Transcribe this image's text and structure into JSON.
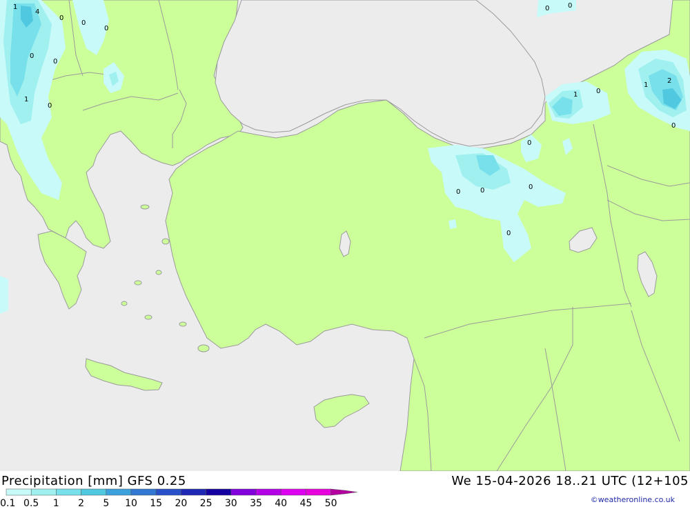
{
  "map": {
    "contour_labels": [
      "1",
      "4",
      "0",
      "0",
      "0",
      "0",
      "0",
      "1",
      "0",
      "0",
      "0",
      "1",
      "0",
      "1",
      "2",
      "0",
      "0",
      "0",
      "0",
      "0",
      "0"
    ],
    "colors": {
      "sea": "#ececec",
      "land": "#ccff99",
      "border": "#9a9a9a",
      "precip_0_1": "#c8fafa",
      "precip_0_5": "#a0f0f0",
      "precip_1": "#78e0ea",
      "precip_2": "#50c8e0"
    }
  },
  "footer": {
    "title_left": "Precipitation [mm] GFS 0.25",
    "title_right": "We 15-04-2026 18..21 UTC (12+105",
    "credit": "©weatheronline.co.uk"
  },
  "legend": {
    "ticks": [
      "0.1",
      "0.5",
      "1",
      "2",
      "5",
      "10",
      "15",
      "20",
      "25",
      "30",
      "35",
      "40",
      "45",
      "50"
    ],
    "colors": [
      "#c8fafa",
      "#a0f0f0",
      "#78e0ea",
      "#50c8e0",
      "#3ca0dc",
      "#3278d2",
      "#2850c8",
      "#1e28b4",
      "#1400a0",
      "#8200dc",
      "#b400e6",
      "#dc00f0",
      "#e600dc",
      "#b4009e"
    ]
  }
}
